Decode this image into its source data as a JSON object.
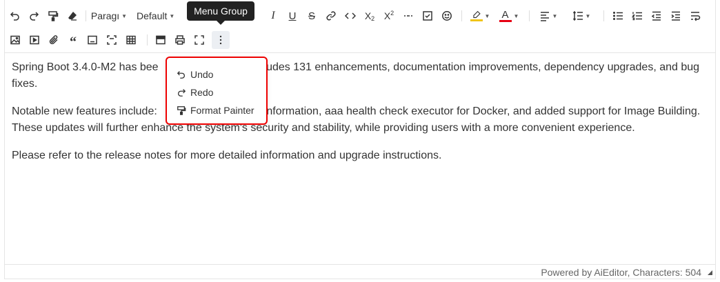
{
  "toolbar": {
    "paragraph_label": "Paragı",
    "font_family_label": "Default",
    "tooltip": "Menu Group",
    "highlight_color": "#f0c419",
    "font_color": "#e60012"
  },
  "content": {
    "paragraphs": [
      "Spring Boot 3.4.0-M2 has bee                     rsion includes 131 enhancements, documentation improvements, dependency upgrades, and bug fixes.",
      "Notable new features include:                      for SSL information, aaa health check executor for Docker, and added support for Image Building. These updates will further enhance the system's security and stability, while providing users with a more convenient experience.",
      "Please refer to the release notes for more detailed information and upgrade instructions."
    ]
  },
  "menu": {
    "items": [
      {
        "label": "Undo",
        "icon": "undo-icon"
      },
      {
        "label": "Redo",
        "icon": "redo-icon"
      },
      {
        "label": "Format Painter",
        "icon": "format-painter-icon"
      }
    ]
  },
  "footer": {
    "text": "Powered by AiEditor, Characters: 504"
  }
}
